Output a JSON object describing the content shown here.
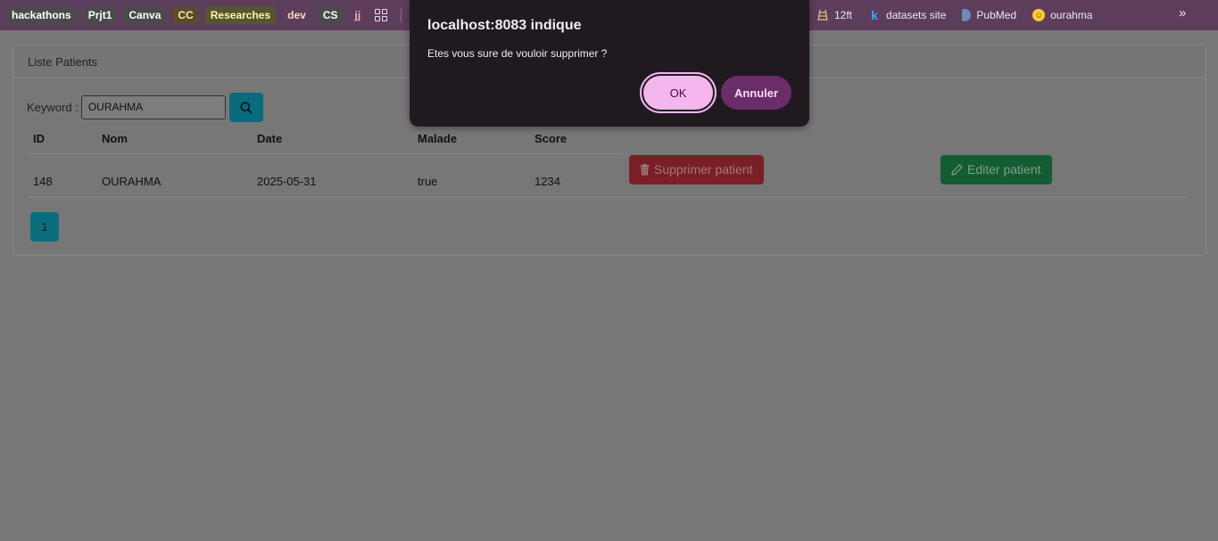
{
  "bookmarks": {
    "folders": [
      "hackathons",
      "Prjt1",
      "Canva",
      "CC",
      "Researches",
      "dev",
      "CS",
      "jj"
    ],
    "links": [
      {
        "label": "12ft",
        "icon": "ladder-icon"
      },
      {
        "label": "datasets site",
        "icon": "kaggle-icon"
      },
      {
        "label": "PubMed",
        "icon": "pubmed-icon"
      },
      {
        "label": "ourahma",
        "icon": "hugging-face-icon"
      }
    ],
    "more_label": "»"
  },
  "card": {
    "header": "Liste Patients",
    "keyword_label": "Keyword :",
    "keyword_value": "OURAHMA",
    "columns": [
      "ID",
      "Nom",
      "Date",
      "Malade",
      "Score"
    ],
    "rows": [
      {
        "id": "148",
        "nom": "OURAHMA",
        "date": "2025-05-31",
        "malade": "true",
        "score": "1234"
      }
    ],
    "delete_label": "Supprimer patient",
    "edit_label": "Editer patient",
    "pages": [
      "1"
    ]
  },
  "dialog": {
    "title": "localhost:8083 indique",
    "message": "Etes vous sure de vouloir supprimer ?",
    "ok_label": "OK",
    "cancel_label": "Annuler"
  },
  "colors": {
    "overlay": "#777777",
    "dialog_bg": "#201a20",
    "ok": "#f4b6ec",
    "cancel": "#6b2d6a",
    "delete": "#7a1f26",
    "edit": "#145c34",
    "primary": "#086c7e"
  }
}
